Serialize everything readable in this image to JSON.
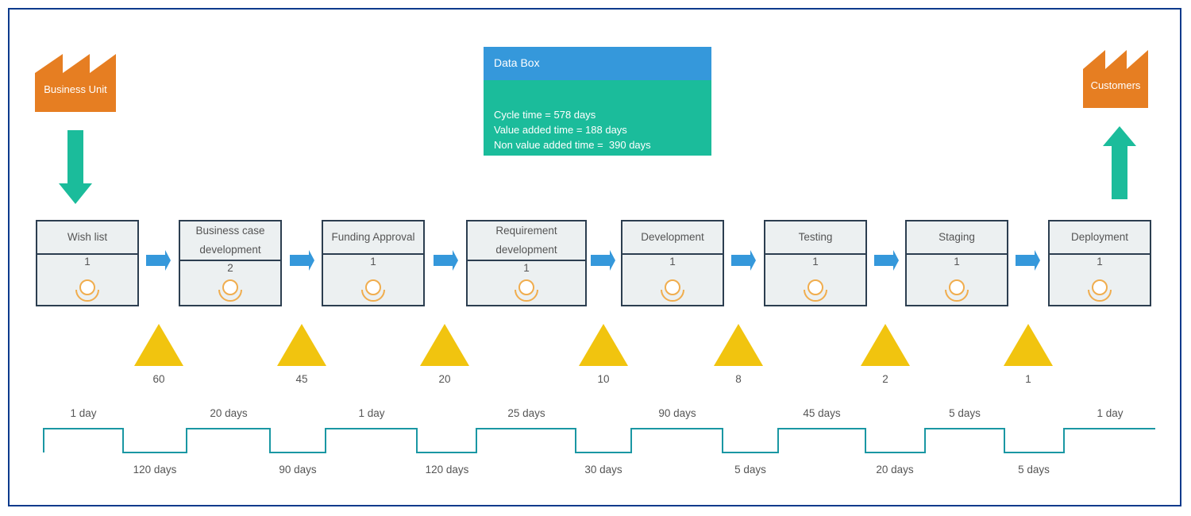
{
  "colors": {
    "frame": "#0b3a8c",
    "factory": "#e67e22",
    "teal_arrow": "#1bbc9b",
    "flow_arrow": "#3598db",
    "inventory": "#f1c40f",
    "operator": "#f0ad4e",
    "process_border": "#2c3e50",
    "process_fill": "#ecf0f1",
    "timeline": "#1a97a3"
  },
  "supplier": {
    "label": "Business Unit",
    "icon": "factory-icon"
  },
  "customer": {
    "label": "Customers",
    "icon": "factory-icon"
  },
  "data_box": {
    "title": "Data Box",
    "lines": [
      "Cycle time = 578 days",
      "Value added time = 188 days",
      "Non value added time =  390 days"
    ]
  },
  "processes": [
    {
      "title": "Wish list",
      "operators": "1"
    },
    {
      "title": "Business case development",
      "operators": "2"
    },
    {
      "title": "Funding Approval",
      "operators": "1"
    },
    {
      "title": "Requirement development",
      "operators": "1"
    },
    {
      "title": "Development",
      "operators": "1"
    },
    {
      "title": "Testing",
      "operators": "1"
    },
    {
      "title": "Staging",
      "operators": "1"
    },
    {
      "title": "Deployment",
      "operators": "1"
    }
  ],
  "inventory": [
    "60",
    "45",
    "20",
    "10",
    "8",
    "2",
    "1"
  ],
  "timeline": {
    "value_added": [
      "1 day",
      "20 days",
      "1 day",
      "25 days",
      "90 days",
      "45 days",
      "5 days",
      "1 day"
    ],
    "wait_times": [
      "120 days",
      "90 days",
      "120 days",
      "30 days",
      "5 days",
      "20 days",
      "5 days"
    ]
  }
}
